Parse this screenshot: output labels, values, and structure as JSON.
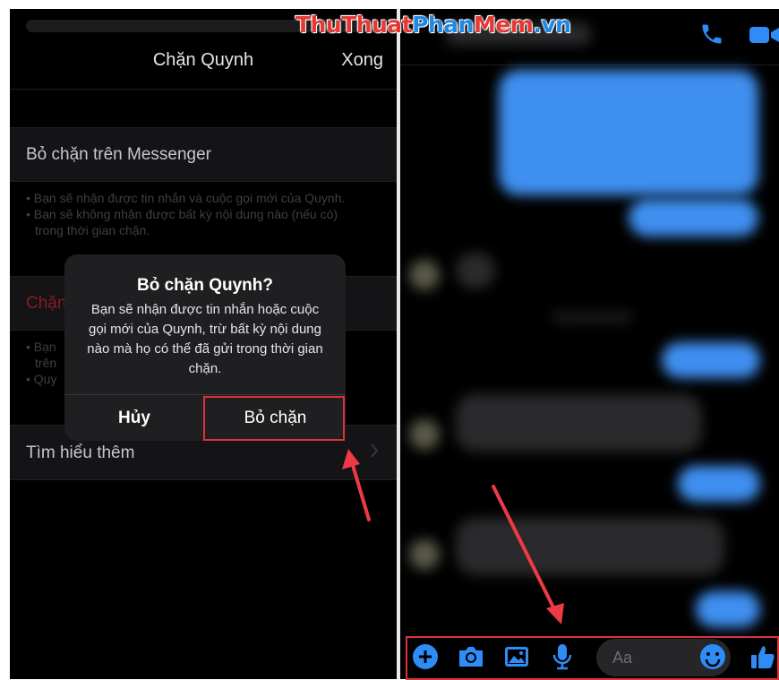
{
  "block_screen": {
    "title": "Chặn Quynh",
    "done_label": "Xong",
    "messenger_row_label": "Bỏ chặn trên Messenger",
    "messenger_footer": [
      "• Bạn sẽ nhận được tin nhắn và cuộc gọi mới của Quynh.",
      "• Bạn sẽ không nhận được bất kỳ nội dung nào (nếu có)",
      "trong thời gian chặn."
    ],
    "facebook_row_label": "Chặn",
    "facebook_footer": [
      "• Bạn",
      "trên",
      "• Quy"
    ],
    "learn_more_label": "Tìm hiểu thêm"
  },
  "dialog": {
    "title": "Bỏ chặn Quynh?",
    "message": "Bạn sẽ nhận được tin nhắn hoặc cuộc gọi mới của Quynh, trừ bất kỳ nội dung nào mà họ có thể đã gửi trong thời gian chặn.",
    "cancel_label": "Hủy",
    "confirm_label": "Bỏ chặn"
  },
  "chat": {
    "composer_placeholder": "Aa",
    "toolbar_icons": [
      "plus-icon",
      "camera-icon",
      "image-icon",
      "microphone-icon",
      "emoji-icon",
      "like-icon"
    ]
  },
  "watermark": {
    "part1": "Thu",
    "part2": "Thuat",
    "part3": "Phan",
    "part4": "Mem",
    "part5": ".vn"
  },
  "colors": {
    "accent_blue": "#2e8cf7",
    "highlight_red": "#e0313a",
    "destructive_red": "#8a1c20"
  }
}
